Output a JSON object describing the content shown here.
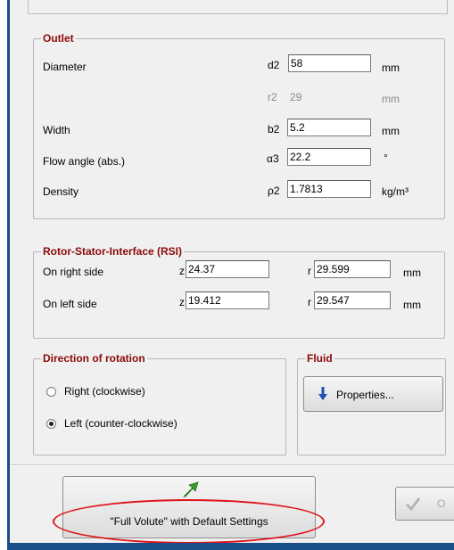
{
  "outlet": {
    "title": "Outlet",
    "rows": [
      {
        "label": "Diameter",
        "symbol": "d2",
        "value": "58",
        "unit": "mm"
      },
      {
        "label": "",
        "symbol": "r2",
        "value": "29",
        "unit": "mm"
      },
      {
        "label": "Width",
        "symbol": "b2",
        "value": "5.2",
        "unit": "mm"
      },
      {
        "label": "Flow angle (abs.)",
        "symbol": "α3",
        "value": "22.2",
        "unit": "°"
      },
      {
        "label": "Density",
        "symbol": "ρ2",
        "value": "1.7813",
        "unit": "kg/m³"
      }
    ]
  },
  "rsi": {
    "title": "Rotor-Stator-Interface (RSI)",
    "rows": [
      {
        "label": "On right side",
        "z_symbol": "z",
        "z_value": "24.37",
        "r_symbol": "r",
        "r_value": "29.599",
        "unit": "mm"
      },
      {
        "label": "On left side",
        "z_symbol": "z",
        "z_value": "19.412",
        "r_symbol": "r",
        "r_value": "29.547",
        "unit": "mm"
      }
    ]
  },
  "rotation": {
    "title": "Direction of rotation",
    "options": [
      {
        "label": "Right (clockwise)",
        "selected": false
      },
      {
        "label": "Left (counter-clockwise)",
        "selected": true
      }
    ]
  },
  "fluid": {
    "title": "Fluid",
    "button_label": "Properties...",
    "icon": "down-arrow-icon"
  },
  "footer": {
    "full_volute_label": "\"Full Volute\" with Default Settings",
    "full_volute_icon": "green-arrow-icon",
    "ok_icon": "checkmark-icon",
    "ok_partial_label": "O"
  },
  "colors": {
    "group_title": "#8b0a0a",
    "highlight_ellipse": "#e0121a",
    "window_frame": "#1a4f8b",
    "arrow_blue": "#1c4fb8",
    "arrow_green": "#3aa12e"
  }
}
